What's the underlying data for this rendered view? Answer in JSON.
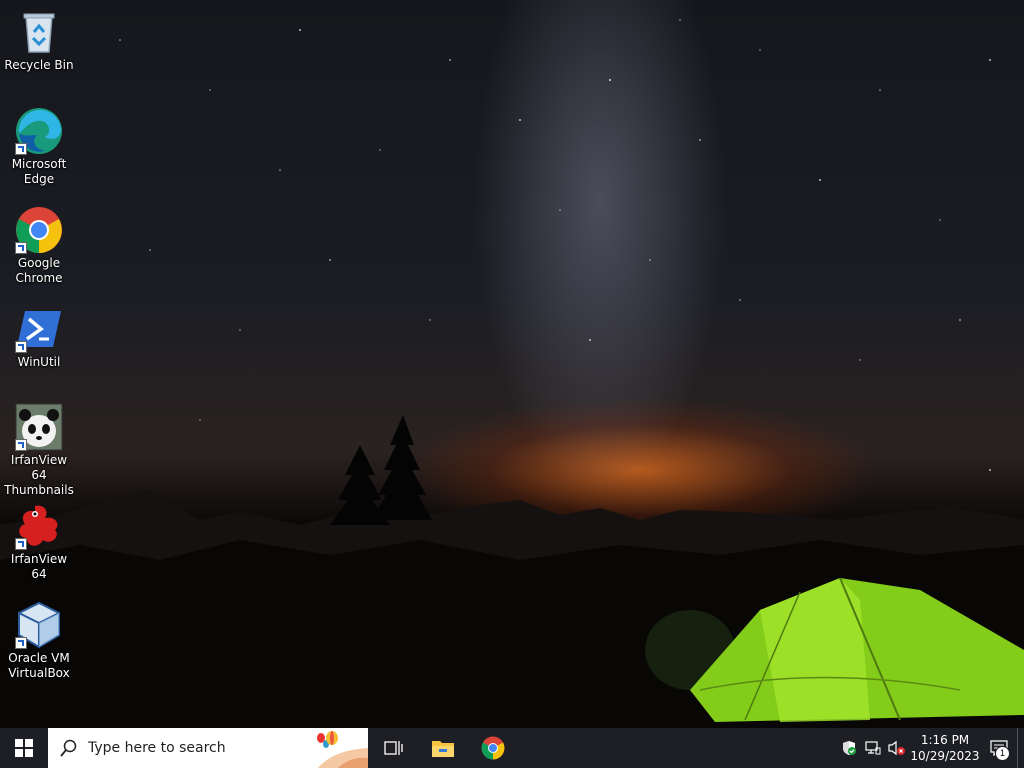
{
  "desktop_icons": [
    {
      "label": "Recycle Bin",
      "icon": "recycle-bin-icon",
      "shortcut": false
    },
    {
      "label": "Microsoft\nEdge",
      "icon": "edge-icon",
      "shortcut": true
    },
    {
      "label": "Google\nChrome",
      "icon": "chrome-icon",
      "shortcut": true
    },
    {
      "label": "WinUtil",
      "icon": "powershell-icon",
      "shortcut": true
    },
    {
      "label": "IrfanView 64\nThumbnails",
      "icon": "irfanview-thumbnails-icon",
      "shortcut": true
    },
    {
      "label": "IrfanView 64",
      "icon": "irfanview-icon",
      "shortcut": true
    },
    {
      "label": "Oracle VM\nVirtualBox",
      "icon": "virtualbox-icon",
      "shortcut": true
    }
  ],
  "taskbar": {
    "search_placeholder": "Type here to search",
    "pinned": [
      {
        "name": "task-view",
        "icon": "task-view-icon"
      },
      {
        "name": "file-explorer",
        "icon": "folder-icon"
      },
      {
        "name": "chrome",
        "icon": "chrome-icon"
      }
    ],
    "time": "1:16 PM",
    "date": "10/29/2023",
    "notification_count": "1"
  },
  "colors": {
    "taskbar": "#1d1f24",
    "start_blue": "#ffffff",
    "tent": "#8ed81e",
    "sky_glow": "#e06a1c"
  }
}
